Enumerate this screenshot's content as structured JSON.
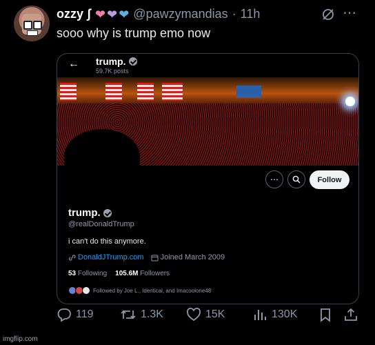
{
  "post": {
    "display_name": "ozzy ʃ",
    "emoji_hearts": [
      "pink-heart",
      "purple-heart",
      "blue-heart"
    ],
    "handle": "@pawzymandias",
    "separator": "·",
    "time": "11h",
    "text": "sooo why is trump emo now",
    "icons": [
      "grok-icon",
      "more-icon"
    ]
  },
  "embedded_profile": {
    "header_name": "trump.",
    "header_posts": "59.7K posts",
    "buttons": {
      "more": "more-icon",
      "search": "search-icon",
      "follow_label": "Follow"
    },
    "name": "trump.",
    "handle": "@realDonaldTrump",
    "bio": "i can't do this anymore.",
    "website": "DonaldJTrump.com",
    "joined": "Joined March 2009",
    "following_count": "53",
    "following_label": "Following",
    "followers_count": "105.6M",
    "followers_label": "Followers",
    "followed_by": "Followed by Joe L., Identical, and Imacoolone48"
  },
  "actions": {
    "replies": "119",
    "reposts": "1.3K",
    "likes": "15K",
    "views": "130K"
  },
  "watermark": "imgflip.com",
  "colors": {
    "accent": "#1d9bf0",
    "background": "#000000",
    "muted": "#8b98a5"
  }
}
